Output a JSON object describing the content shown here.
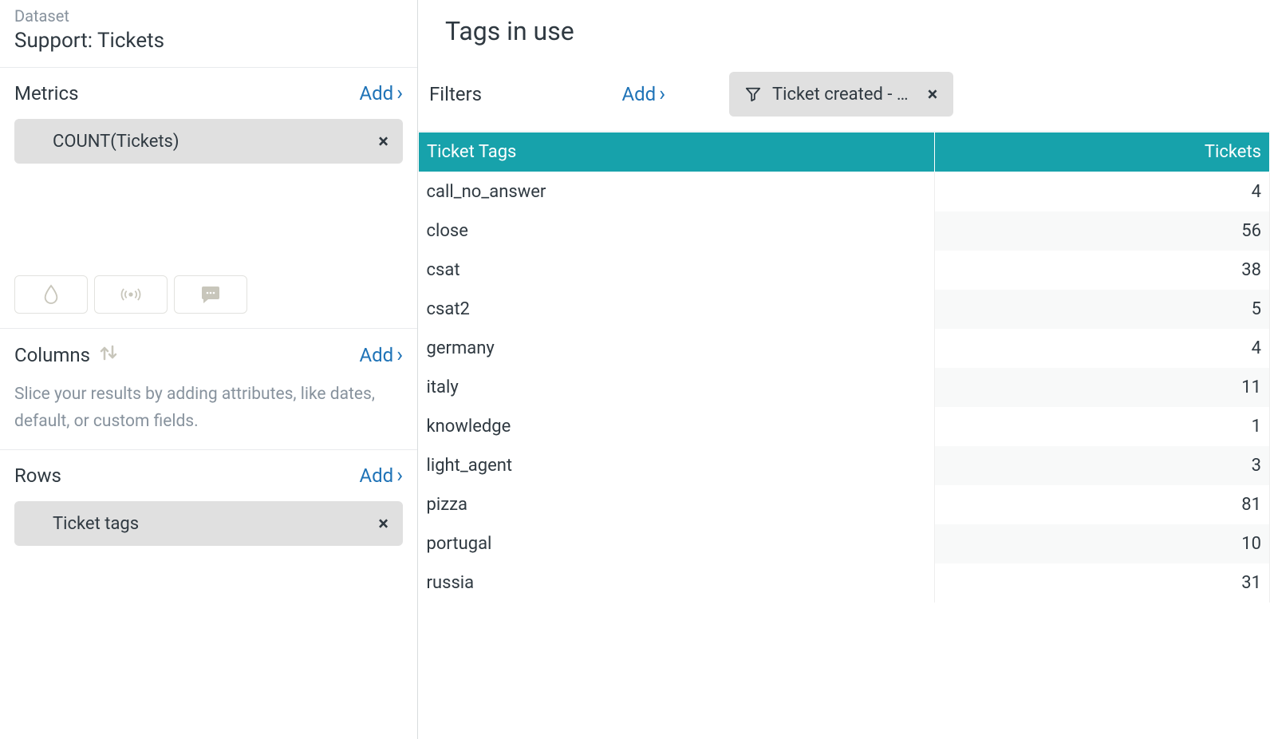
{
  "dataset": {
    "label": "Dataset",
    "name": "Support: Tickets"
  },
  "metrics": {
    "title": "Metrics",
    "add_label": "Add",
    "item": "COUNT(Tickets)"
  },
  "columns": {
    "title": "Columns",
    "add_label": "Add",
    "description": "Slice your results by adding attributes, like dates, default, or custom fields."
  },
  "rows": {
    "title": "Rows",
    "add_label": "Add",
    "item": "Ticket tags"
  },
  "main": {
    "title": "Tags in use"
  },
  "filters": {
    "title": "Filters",
    "add_label": "Add",
    "chip_label": "Ticket created - …"
  },
  "table": {
    "header_tags": "Ticket Tags",
    "header_tickets": "Tickets",
    "rows": [
      {
        "tag": "call_no_answer",
        "count": 4
      },
      {
        "tag": "close",
        "count": 56
      },
      {
        "tag": "csat",
        "count": 38
      },
      {
        "tag": "csat2",
        "count": 5
      },
      {
        "tag": "germany",
        "count": 4
      },
      {
        "tag": "italy",
        "count": 11
      },
      {
        "tag": "knowledge",
        "count": 1
      },
      {
        "tag": "light_agent",
        "count": 3
      },
      {
        "tag": "pizza",
        "count": 81
      },
      {
        "tag": "portugal",
        "count": 10
      },
      {
        "tag": "russia",
        "count": 31
      }
    ]
  }
}
